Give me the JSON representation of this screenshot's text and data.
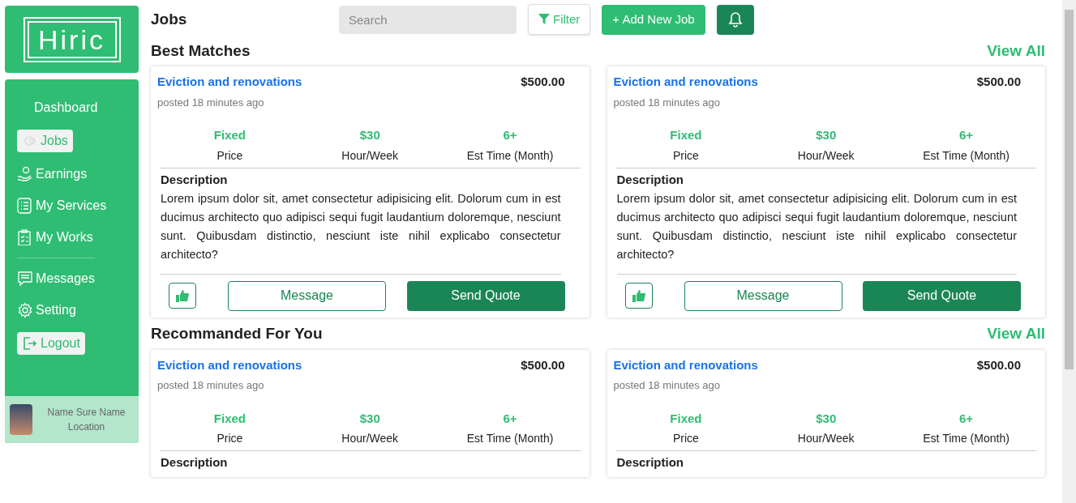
{
  "logo": {
    "text": "Hiric"
  },
  "sidebar": {
    "items": [
      {
        "label": "Dashboard",
        "kind": "link",
        "selected": false
      },
      {
        "label": "Jobs",
        "kind": "link",
        "selected": true
      },
      {
        "label": "Earnings",
        "kind": "link",
        "selected": false
      },
      {
        "label": "My Services",
        "kind": "link",
        "selected": false
      },
      {
        "label": "My Works",
        "kind": "link",
        "selected": false
      },
      {
        "kind": "divider"
      },
      {
        "label": "Messages",
        "kind": "link",
        "selected": false
      },
      {
        "label": "Setting",
        "kind": "link",
        "selected": false
      },
      {
        "label": "Logout",
        "kind": "button",
        "selected": false
      }
    ]
  },
  "profile": {
    "name": "Name Sure Name",
    "location": "Location"
  },
  "header": {
    "title": "Jobs",
    "search": {
      "placeholder": "Search"
    },
    "filter": "Filter",
    "add": "+ Add New Job"
  },
  "sections": [
    {
      "title": "Best Matches",
      "view_all": "View All",
      "cards": [
        {
          "title": "Eviction and renovations",
          "price": "$500.00",
          "posted": "posted 18 minutes ago",
          "stats": [
            {
              "value": "Fixed",
              "label": "Price"
            },
            {
              "value": "$30",
              "label": "Hour/Week"
            },
            {
              "value": "6+",
              "label": "Est Time (Month)"
            }
          ],
          "description_heading": "Description",
          "description": "Lorem ipsum dolor sit, amet consectetur adipisicing elit. Dolorum cum in est ducimus architecto quo adipisci sequi fugit laudantium doloremque, nesciunt sunt. Quibusdam distinctio, nesciunt iste nihil explicabo consectetur architecto?",
          "message": "Message",
          "quote": "Send Quote"
        },
        {
          "title": "Eviction and renovations",
          "price": "$500.00",
          "posted": "posted 18 minutes ago",
          "stats": [
            {
              "value": "Fixed",
              "label": "Price"
            },
            {
              "value": "$30",
              "label": "Hour/Week"
            },
            {
              "value": "6+",
              "label": "Est Time (Month)"
            }
          ],
          "description_heading": "Description",
          "description": "Lorem ipsum dolor sit, amet consectetur adipisicing elit. Dolorum cum in est ducimus architecto quo adipisci sequi fugit laudantium doloremque, nesciunt sunt. Quibusdam distinctio, nesciunt iste nihil explicabo consectetur architecto?",
          "message": "Message",
          "quote": "Send Quote"
        }
      ]
    },
    {
      "title": "Recommanded For You",
      "view_all": "View All",
      "cards": [
        {
          "title": "Eviction and renovations",
          "price": "$500.00",
          "posted": "posted 18 minutes ago",
          "stats": [
            {
              "value": "Fixed",
              "label": "Price"
            },
            {
              "value": "$30",
              "label": "Hour/Week"
            },
            {
              "value": "6+",
              "label": "Est Time (Month)"
            }
          ],
          "description_heading": "Description"
        },
        {
          "title": "Eviction and renovations",
          "price": "$500.00",
          "posted": "posted 18 minutes ago",
          "stats": [
            {
              "value": "Fixed",
              "label": "Price"
            },
            {
              "value": "$30",
              "label": "Hour/Week"
            },
            {
              "value": "6+",
              "label": "Est Time (Month)"
            }
          ],
          "description_heading": "Description"
        }
      ]
    }
  ]
}
